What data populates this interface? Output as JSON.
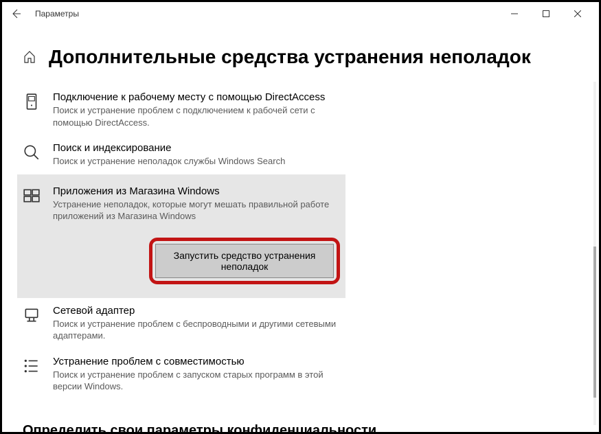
{
  "titlebar": {
    "title": "Параметры"
  },
  "page": {
    "title": "Дополнительные средства устранения неполадок"
  },
  "items": [
    {
      "title": "Подключение к рабочему месту с помощью DirectAccess",
      "desc": "Поиск и устранение проблем с подключением к рабочей сети с помощью DirectAccess."
    },
    {
      "title": "Поиск и индексирование",
      "desc": "Поиск и устранение неполадок службы Windows Search"
    },
    {
      "title": "Приложения из Магазина Windows",
      "desc": "Устранение неполадок, которые могут мешать правильной работе приложений из Магазина Windows",
      "button": "Запустить средство устранения неполадок"
    },
    {
      "title": "Сетевой адаптер",
      "desc": "Поиск и устранение проблем с беспроводными и другими сетевыми адаптерами."
    },
    {
      "title": "Устранение проблем с совместимостью",
      "desc": "Поиск и устранение проблем с запуском старых программ в этой версии Windows."
    }
  ],
  "section_heading": "Определить свои параметры конфиденциальности"
}
